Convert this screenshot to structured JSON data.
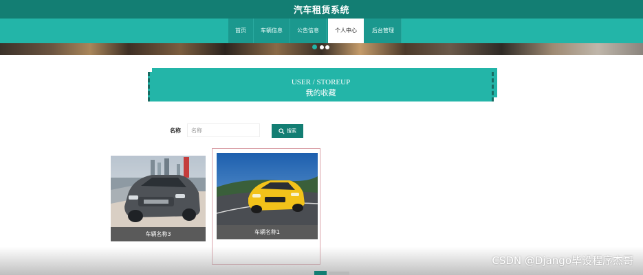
{
  "header": {
    "site_title": "汽车租赁系统"
  },
  "nav": {
    "items": [
      {
        "label": "首页",
        "active": false
      },
      {
        "label": "车辆信息",
        "active": false
      },
      {
        "label": "公告信息",
        "active": false
      },
      {
        "label": "个人中心",
        "active": true
      },
      {
        "label": "后台管理",
        "active": false
      }
    ]
  },
  "banner": {
    "dots": 3,
    "active_dot": 1
  },
  "heading": {
    "en": "USER / STOREUP",
    "cn": "我的收藏"
  },
  "search": {
    "label": "名称",
    "placeholder": "名称",
    "value": "",
    "button_label": "搜索"
  },
  "cards": [
    {
      "name": "车辆名称3"
    },
    {
      "name": "车辆名称1"
    }
  ],
  "watermark": "CSDN @Django毕设程序杰哥",
  "colors": {
    "primary_dark": "#137e73",
    "primary": "#23b5a8",
    "caption_bg": "#5a5a5a"
  }
}
